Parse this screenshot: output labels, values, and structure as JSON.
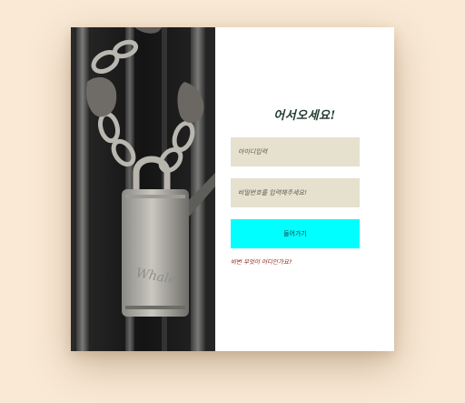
{
  "login": {
    "title": "어서오세요!",
    "id_placeholder": "아이디입력",
    "password_placeholder": "비밀번호를 입력해주세요!",
    "login_button": "들어가기",
    "forgot_link": "비번 무엇이 어디인가요?"
  },
  "colors": {
    "page_background": "#f9e9d5",
    "card_background": "#ffffff",
    "input_background": "#e6e0cf",
    "button_background": "#00ffff",
    "title_color": "#223a2e",
    "link_color": "#8a1e12"
  },
  "image": {
    "subject": "padlock-and-chain-photo"
  }
}
